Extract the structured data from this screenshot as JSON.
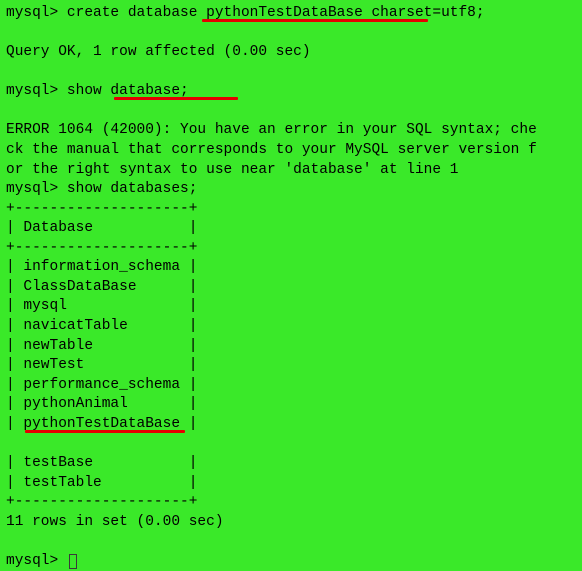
{
  "prompt": "mysql> ",
  "cmd1": "create database pythonTestDataBase charset=utf8;",
  "resp1": "Query OK, 1 row affected (0.00 sec)",
  "cmd2": "show database;",
  "err2a": "ERROR 1064 (42000): You have an error in your SQL syntax; che",
  "err2b": "ck the manual that corresponds to your MySQL server version f",
  "err2c": "or the right syntax to use near 'database' at line 1",
  "cmd3": "show databases;",
  "tbl": {
    "sep": "+--------------------+",
    "header": "| Database           |",
    "rows": [
      "| information_schema |",
      "| ClassDataBase      |",
      "| mysql              |",
      "| navicatTable       |",
      "| newTable           |",
      "| newTest            |",
      "| performance_schema |",
      "| pythonAnimal       |",
      "| pythonTestDataBase |",
      "| testBase           |",
      "| testTable          |"
    ]
  },
  "resp3": "11 rows in set (0.00 sec)"
}
